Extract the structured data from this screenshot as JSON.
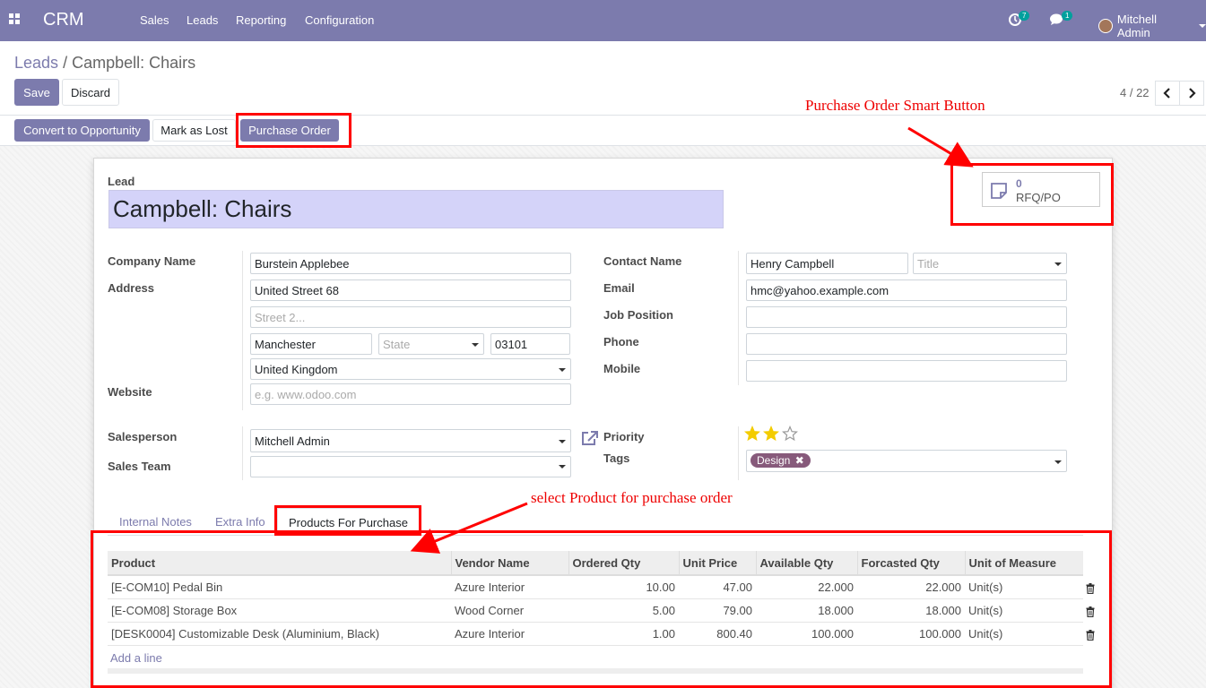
{
  "navbar": {
    "brand": "CRM",
    "menu": [
      "Sales",
      "Leads",
      "Reporting",
      "Configuration"
    ],
    "activity_count": "7",
    "message_count": "1",
    "user": "Mitchell Admin"
  },
  "breadcrumb": {
    "parent": "Leads",
    "separator": "/",
    "current": "Campbell: Chairs"
  },
  "toolbar": {
    "save": "Save",
    "discard": "Discard"
  },
  "pager": {
    "value": "4 / 22"
  },
  "statusbar": {
    "convert": "Convert to Opportunity",
    "mark_lost": "Mark as Lost",
    "purchase_order": "Purchase Order"
  },
  "smart_button": {
    "count": "0",
    "label": "RFQ/PO"
  },
  "form": {
    "lead_label": "Lead",
    "lead_name": "Campbell: Chairs",
    "labels": {
      "company_name": "Company Name",
      "address": "Address",
      "website": "Website",
      "contact_name": "Contact Name",
      "email": "Email",
      "job_position": "Job Position",
      "phone": "Phone",
      "mobile": "Mobile",
      "salesperson": "Salesperson",
      "sales_team": "Sales Team",
      "priority": "Priority",
      "tags": "Tags"
    },
    "values": {
      "company_name": "Burstein Applebee",
      "street": "United Street 68",
      "city": "Manchester",
      "zip": "03101",
      "country": "United Kingdom",
      "contact_name": "Henry Campbell",
      "email": "hmc@yahoo.example.com",
      "salesperson": "Mitchell Admin",
      "tag": "Design"
    },
    "placeholders": {
      "street2": "Street 2...",
      "state": "State",
      "website": "e.g. www.odoo.com",
      "title": "Title"
    },
    "priority_stars": 2,
    "priority_max": 3
  },
  "tabs": [
    "Internal Notes",
    "Extra Info",
    "Products For Purchase"
  ],
  "lines": {
    "headers": [
      "Product",
      "Vendor Name",
      "Ordered Qty",
      "Unit Price",
      "Available Qty",
      "Forcasted Qty",
      "Unit of Measure"
    ],
    "rows": [
      [
        "[E-COM10] Pedal Bin",
        "Azure Interior",
        "10.00",
        "47.00",
        "22.000",
        "22.000",
        "Unit(s)"
      ],
      [
        "[E-COM08] Storage Box",
        "Wood Corner",
        "5.00",
        "79.00",
        "18.000",
        "18.000",
        "Unit(s)"
      ],
      [
        "[DESK0004] Customizable Desk (Aluminium, Black)",
        "Azure Interior",
        "1.00",
        "800.40",
        "100.000",
        "100.000",
        "Unit(s)"
      ]
    ],
    "add_line": "Add a line"
  },
  "annotations": {
    "smart_button": "Purchase Order  Smart Button",
    "products": "select Product for purchase order"
  },
  "colors": {
    "primary": "#7c7bad",
    "annotation": "#ff0000",
    "star": "#f3cc00"
  }
}
